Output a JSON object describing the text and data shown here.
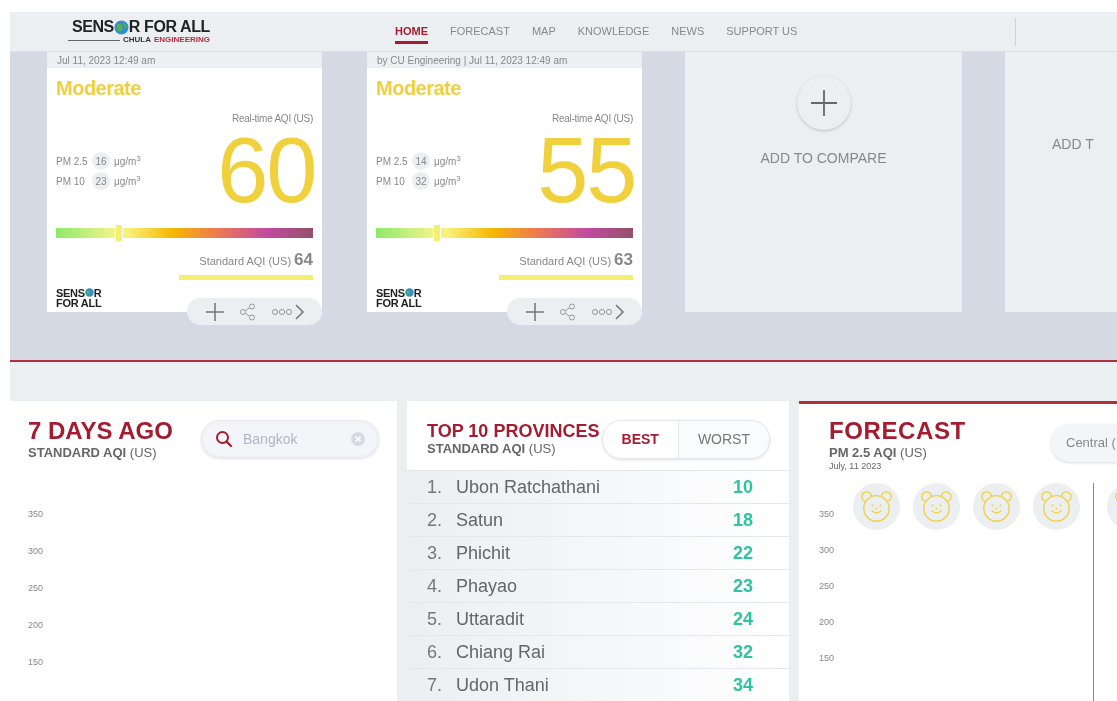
{
  "nav": {
    "logo": {
      "left": "SENS",
      "right": "R FOR ALL",
      "sub_left": "CHULA",
      "sub_right": "ENGINEERING"
    },
    "links": [
      {
        "label": "HOME",
        "selected": true
      },
      {
        "label": "FORECAST",
        "selected": false
      },
      {
        "label": "MAP",
        "selected": false
      },
      {
        "label": "KNOWLEDGE",
        "selected": false
      },
      {
        "label": "NEWS",
        "selected": false
      },
      {
        "label": "SUPPORT US",
        "selected": false
      }
    ]
  },
  "stations": [
    {
      "byline": "Jul 11, 2023 12:49 am",
      "category": "Moderate",
      "realtime_label": "Real-time AQI (US)",
      "pm": [
        {
          "label": "PM 2.5",
          "value": "16",
          "unit": "μg/m$^{3}$"
        },
        {
          "label": "PM 10",
          "value": "23",
          "unit": "μg/m$^{3}$"
        }
      ],
      "aqi": "60",
      "level": 0.23,
      "standard_label": "Standard AQI (US)",
      "standard_value": "64",
      "logo": {
        "top_left": "SENS",
        "top_right": "R",
        "bottom": "FOR ALL"
      }
    },
    {
      "byline": "by CU Engineering | Jul 11, 2023 12:49 am",
      "category": "Moderate",
      "realtime_label": "Real-time AQI (US)",
      "pm": [
        {
          "label": "PM 2.5",
          "value": "14",
          "unit": "μg/m$^{3}$"
        },
        {
          "label": "PM 10",
          "value": "32",
          "unit": "μg/m$^{3}$"
        }
      ],
      "aqi": "55",
      "level": 0.22,
      "standard_label": "Standard AQI (US)",
      "standard_value": "63",
      "logo": {
        "top_left": "SENS",
        "top_right": "R",
        "bottom": "FOR ALL"
      }
    }
  ],
  "compare_slots": [
    "ADD TO COMPARE",
    "ADD T"
  ],
  "history": {
    "title": "7 DAYS AGO",
    "subtitle": "**STANDARD AQI** (US)",
    "search": {
      "placeholder": "Bangkok"
    },
    "y_ticks": [
      "350",
      "300",
      "250",
      "200",
      "150"
    ]
  },
  "top_provinces": {
    "title": "TOP 10 PROVINCES",
    "subtitle": "**STANDARD AQI** (US)",
    "toggle": [
      {
        "label": "BEST",
        "selected": true
      },
      {
        "label": "WORST",
        "selected": false
      }
    ],
    "rows": [
      {
        "rank": "1.",
        "name": "Ubon Ratchathani",
        "value": "10"
      },
      {
        "rank": "2.",
        "name": "Satun",
        "value": "18"
      },
      {
        "rank": "3.",
        "name": "Phichit",
        "value": "22"
      },
      {
        "rank": "4.",
        "name": "Phayao",
        "value": "23"
      },
      {
        "rank": "5.",
        "name": "Uttaradit",
        "value": "24"
      },
      {
        "rank": "6.",
        "name": "Chiang Rai",
        "value": "32"
      },
      {
        "rank": "7.",
        "name": "Udon Thani",
        "value": "34"
      }
    ]
  },
  "forecast": {
    "title": "FORECAST",
    "subtitle": "**PM 2.5 AQI** (US)",
    "date": "July, 11 2023",
    "region": "Central (",
    "y_ticks": [
      "350",
      "300",
      "250",
      "200",
      "150"
    ]
  }
}
